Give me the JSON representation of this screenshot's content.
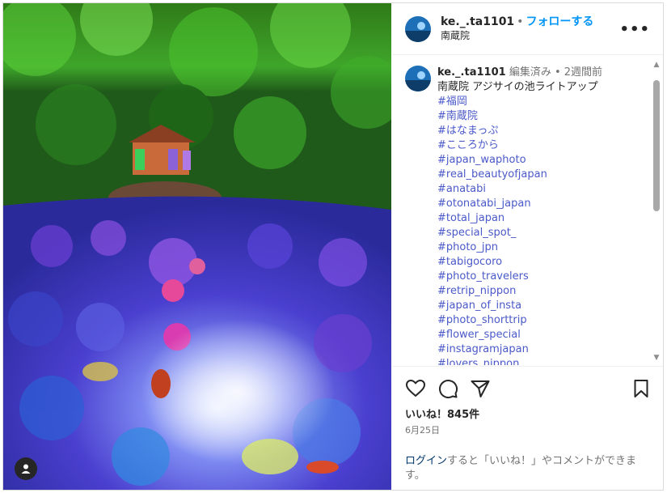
{
  "post": {
    "username": "ke._.ta1101",
    "follow_label": "フォローする",
    "separator": "•",
    "location": "南蔵院",
    "more_label": "•••",
    "photo_alt": "Hydrangea pond light-up photo",
    "user_tag_icon": "user-icon"
  },
  "caption": {
    "username": "ke._.ta1101",
    "edited": "編集済み",
    "separator": "•",
    "age": "2週間前",
    "text": "南蔵院 アジサイの池ライトアップ",
    "hashtags": [
      "#福岡",
      "#南蔵院",
      "#はなまっぷ",
      "#こころから",
      "#japan_waphoto",
      "#real_beautyofjapan",
      "#anatabi",
      "#otonatabi_japan",
      "#total_japan",
      "#special_spot_",
      "#photo_jpn",
      "#tabigocoro",
      "#photo_travelers",
      "#retrip_nippon",
      "#japan_of_insta",
      "#photo_shorttrip",
      "#flower_special",
      "#instagramjapan",
      "#lovers_nippon"
    ]
  },
  "actions": {
    "likes": "いいね！845件",
    "date": "6月25日",
    "login_link": "ログイン",
    "login_text": "すると「いいね！」やコメントができます。"
  },
  "colors": {
    "link": "#00376b",
    "follow": "#0095f6",
    "hashtag": "#4a59c9",
    "muted": "#737373"
  }
}
